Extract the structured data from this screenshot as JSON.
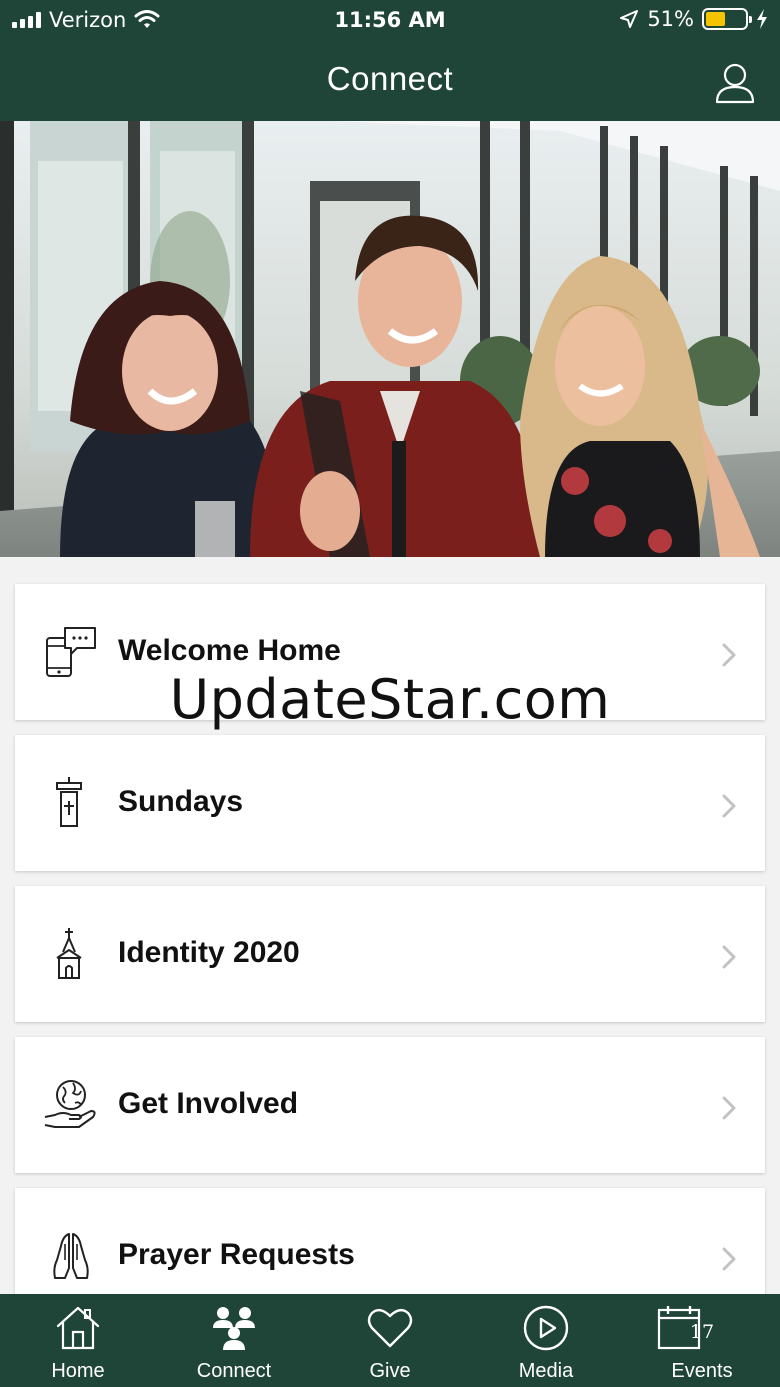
{
  "status_bar": {
    "carrier": "Verizon",
    "time": "11:56 AM",
    "battery_percent": "51%",
    "battery_level": 0.51,
    "icons": [
      "signal-icon",
      "wifi-icon",
      "location-arrow-icon",
      "battery-icon",
      "charging-bolt-icon"
    ]
  },
  "header": {
    "title": "Connect",
    "profile_icon": "user-profile-icon"
  },
  "hero": {
    "description_icon": "photo"
  },
  "menu": {
    "items": [
      {
        "label": "Welcome Home",
        "icon": "phone-chat-icon"
      },
      {
        "label": "Sundays",
        "icon": "pulpit-icon"
      },
      {
        "label": "Identity 2020",
        "icon": "church-icon"
      },
      {
        "label": "Get Involved",
        "icon": "globe-hand-icon"
      },
      {
        "label": "Prayer Requests",
        "icon": "praying-hands-icon"
      }
    ]
  },
  "watermark": "UpdateStar.com",
  "tabs": [
    {
      "label": "Home",
      "icon": "home-icon"
    },
    {
      "label": "Connect",
      "icon": "people-icon"
    },
    {
      "label": "Give",
      "icon": "heart-icon"
    },
    {
      "label": "Media",
      "icon": "play-icon"
    },
    {
      "label": "Events",
      "icon": "calendar-icon",
      "day": "17"
    }
  ],
  "colors": {
    "brand_green": "#1e4537",
    "battery_fill": "#f5c400",
    "background": "#f2f2f2"
  }
}
